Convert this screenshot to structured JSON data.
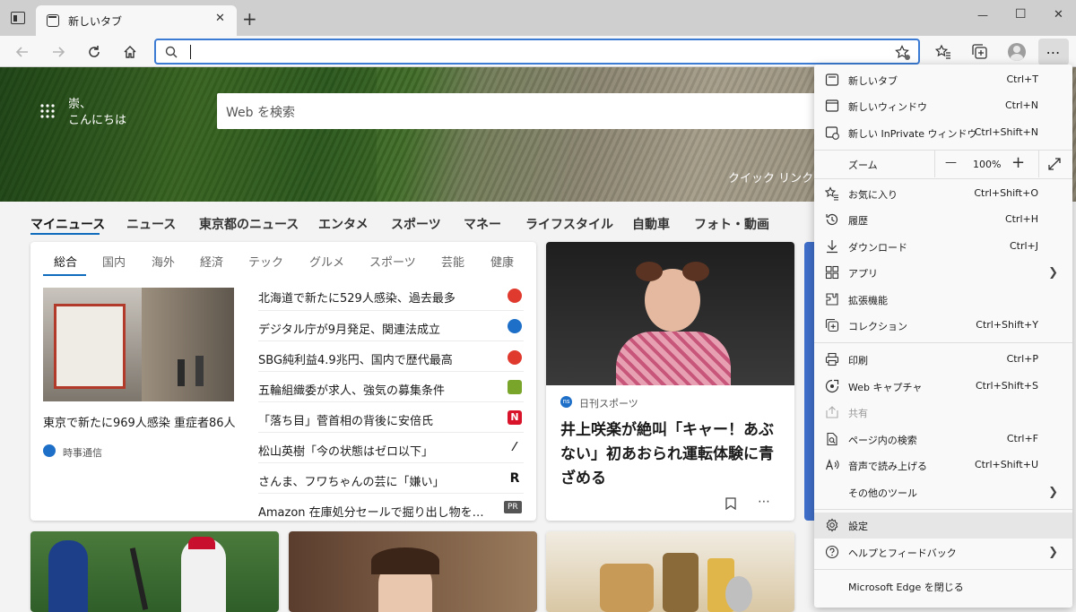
{
  "tab": {
    "title": "新しいタブ"
  },
  "window": {
    "minimize": "—",
    "maximize": "☐",
    "close": "✕"
  },
  "hero": {
    "greeting_line1": "崇、",
    "greeting_line2": "こんにちは",
    "search_placeholder": "Web を検索",
    "quick_links": "クイック リンク"
  },
  "newsnav": [
    "マイニュース",
    "ニュース",
    "東京都のニュース",
    "エンタメ",
    "スポーツ",
    "マネー",
    "ライフスタイル",
    "自動車",
    "フォト・動画"
  ],
  "main_card": {
    "subtabs": [
      "総合",
      "国内",
      "海外",
      "経済",
      "テック",
      "グルメ",
      "スポーツ",
      "芸能",
      "健康"
    ],
    "feature_caption": "東京で新たに969人感染 重症者86人",
    "feature_source": "時事通信",
    "headlines": [
      {
        "text": "北海道で新たに529人感染、過去最多",
        "color": "#e03a2f"
      },
      {
        "text": "デジタル庁が9月発足、関連法成立",
        "color": "#1e6fc8"
      },
      {
        "text": "SBG純利益4.9兆円、国内で歴代最高",
        "color": "#e03a2f"
      },
      {
        "text": "五輪組織委が求人、強気の募集条件",
        "color": "#7aa52b"
      },
      {
        "text": "「落ち目」菅首相の背後に安倍氏",
        "color": "#d9142a"
      },
      {
        "text": "松山英樹「今の状態はゼロ以下」",
        "color": "#333333"
      },
      {
        "text": "さんま、フワちゃんの芸に「嫌い」",
        "color": "#222222"
      },
      {
        "text": "Amazon 在庫処分セールで掘り出し物を…",
        "color": "#555555"
      }
    ],
    "pr_badge": "PR"
  },
  "story_card": {
    "source": "日刊スポーツ",
    "source_badge": "ns",
    "headline": "井上咲楽が絶叫「キャー！あぶない」初あおられ運転体験に青ざめる",
    "more": "⋯"
  },
  "menu": {
    "items_top": [
      {
        "label": "新しいタブ",
        "shortcut": "Ctrl+T",
        "icon": "new-tab-icon"
      },
      {
        "label": "新しいウィンドウ",
        "shortcut": "Ctrl+N",
        "icon": "new-window-icon"
      },
      {
        "label": "新しい InPrivate ウィンドウ",
        "shortcut": "Ctrl+Shift+N",
        "icon": "inprivate-icon"
      }
    ],
    "zoom": {
      "label": "ズーム",
      "minus": "—",
      "value": "100%",
      "plus": "+"
    },
    "items_mid": [
      {
        "label": "お気に入り",
        "shortcut": "Ctrl+Shift+O",
        "icon": "favorites-icon"
      },
      {
        "label": "履歴",
        "shortcut": "Ctrl+H",
        "icon": "history-icon"
      },
      {
        "label": "ダウンロード",
        "shortcut": "Ctrl+J",
        "icon": "download-icon"
      },
      {
        "label": "アプリ",
        "shortcut": "",
        "icon": "apps-icon",
        "arrow": true
      },
      {
        "label": "拡張機能",
        "shortcut": "",
        "icon": "extensions-icon"
      },
      {
        "label": "コレクション",
        "shortcut": "Ctrl+Shift+Y",
        "icon": "collections-icon"
      }
    ],
    "items_tools": [
      {
        "label": "印刷",
        "shortcut": "Ctrl+P",
        "icon": "print-icon"
      },
      {
        "label": "Web キャプチャ",
        "shortcut": "Ctrl+Shift+S",
        "icon": "web-capture-icon"
      },
      {
        "label": "共有",
        "shortcut": "",
        "icon": "share-icon",
        "dim": true
      },
      {
        "label": "ページ内の検索",
        "shortcut": "Ctrl+F",
        "icon": "find-icon"
      },
      {
        "label": "音声で読み上げる",
        "shortcut": "Ctrl+Shift+U",
        "icon": "read-aloud-icon"
      },
      {
        "label": "その他のツール",
        "shortcut": "",
        "icon": "",
        "arrow": true
      }
    ],
    "items_bottom": [
      {
        "label": "設定",
        "shortcut": "",
        "icon": "settings-icon"
      },
      {
        "label": "ヘルプとフィードバック",
        "shortcut": "",
        "icon": "help-icon",
        "arrow": true
      }
    ],
    "close_edge": "Microsoft Edge を閉じる"
  }
}
